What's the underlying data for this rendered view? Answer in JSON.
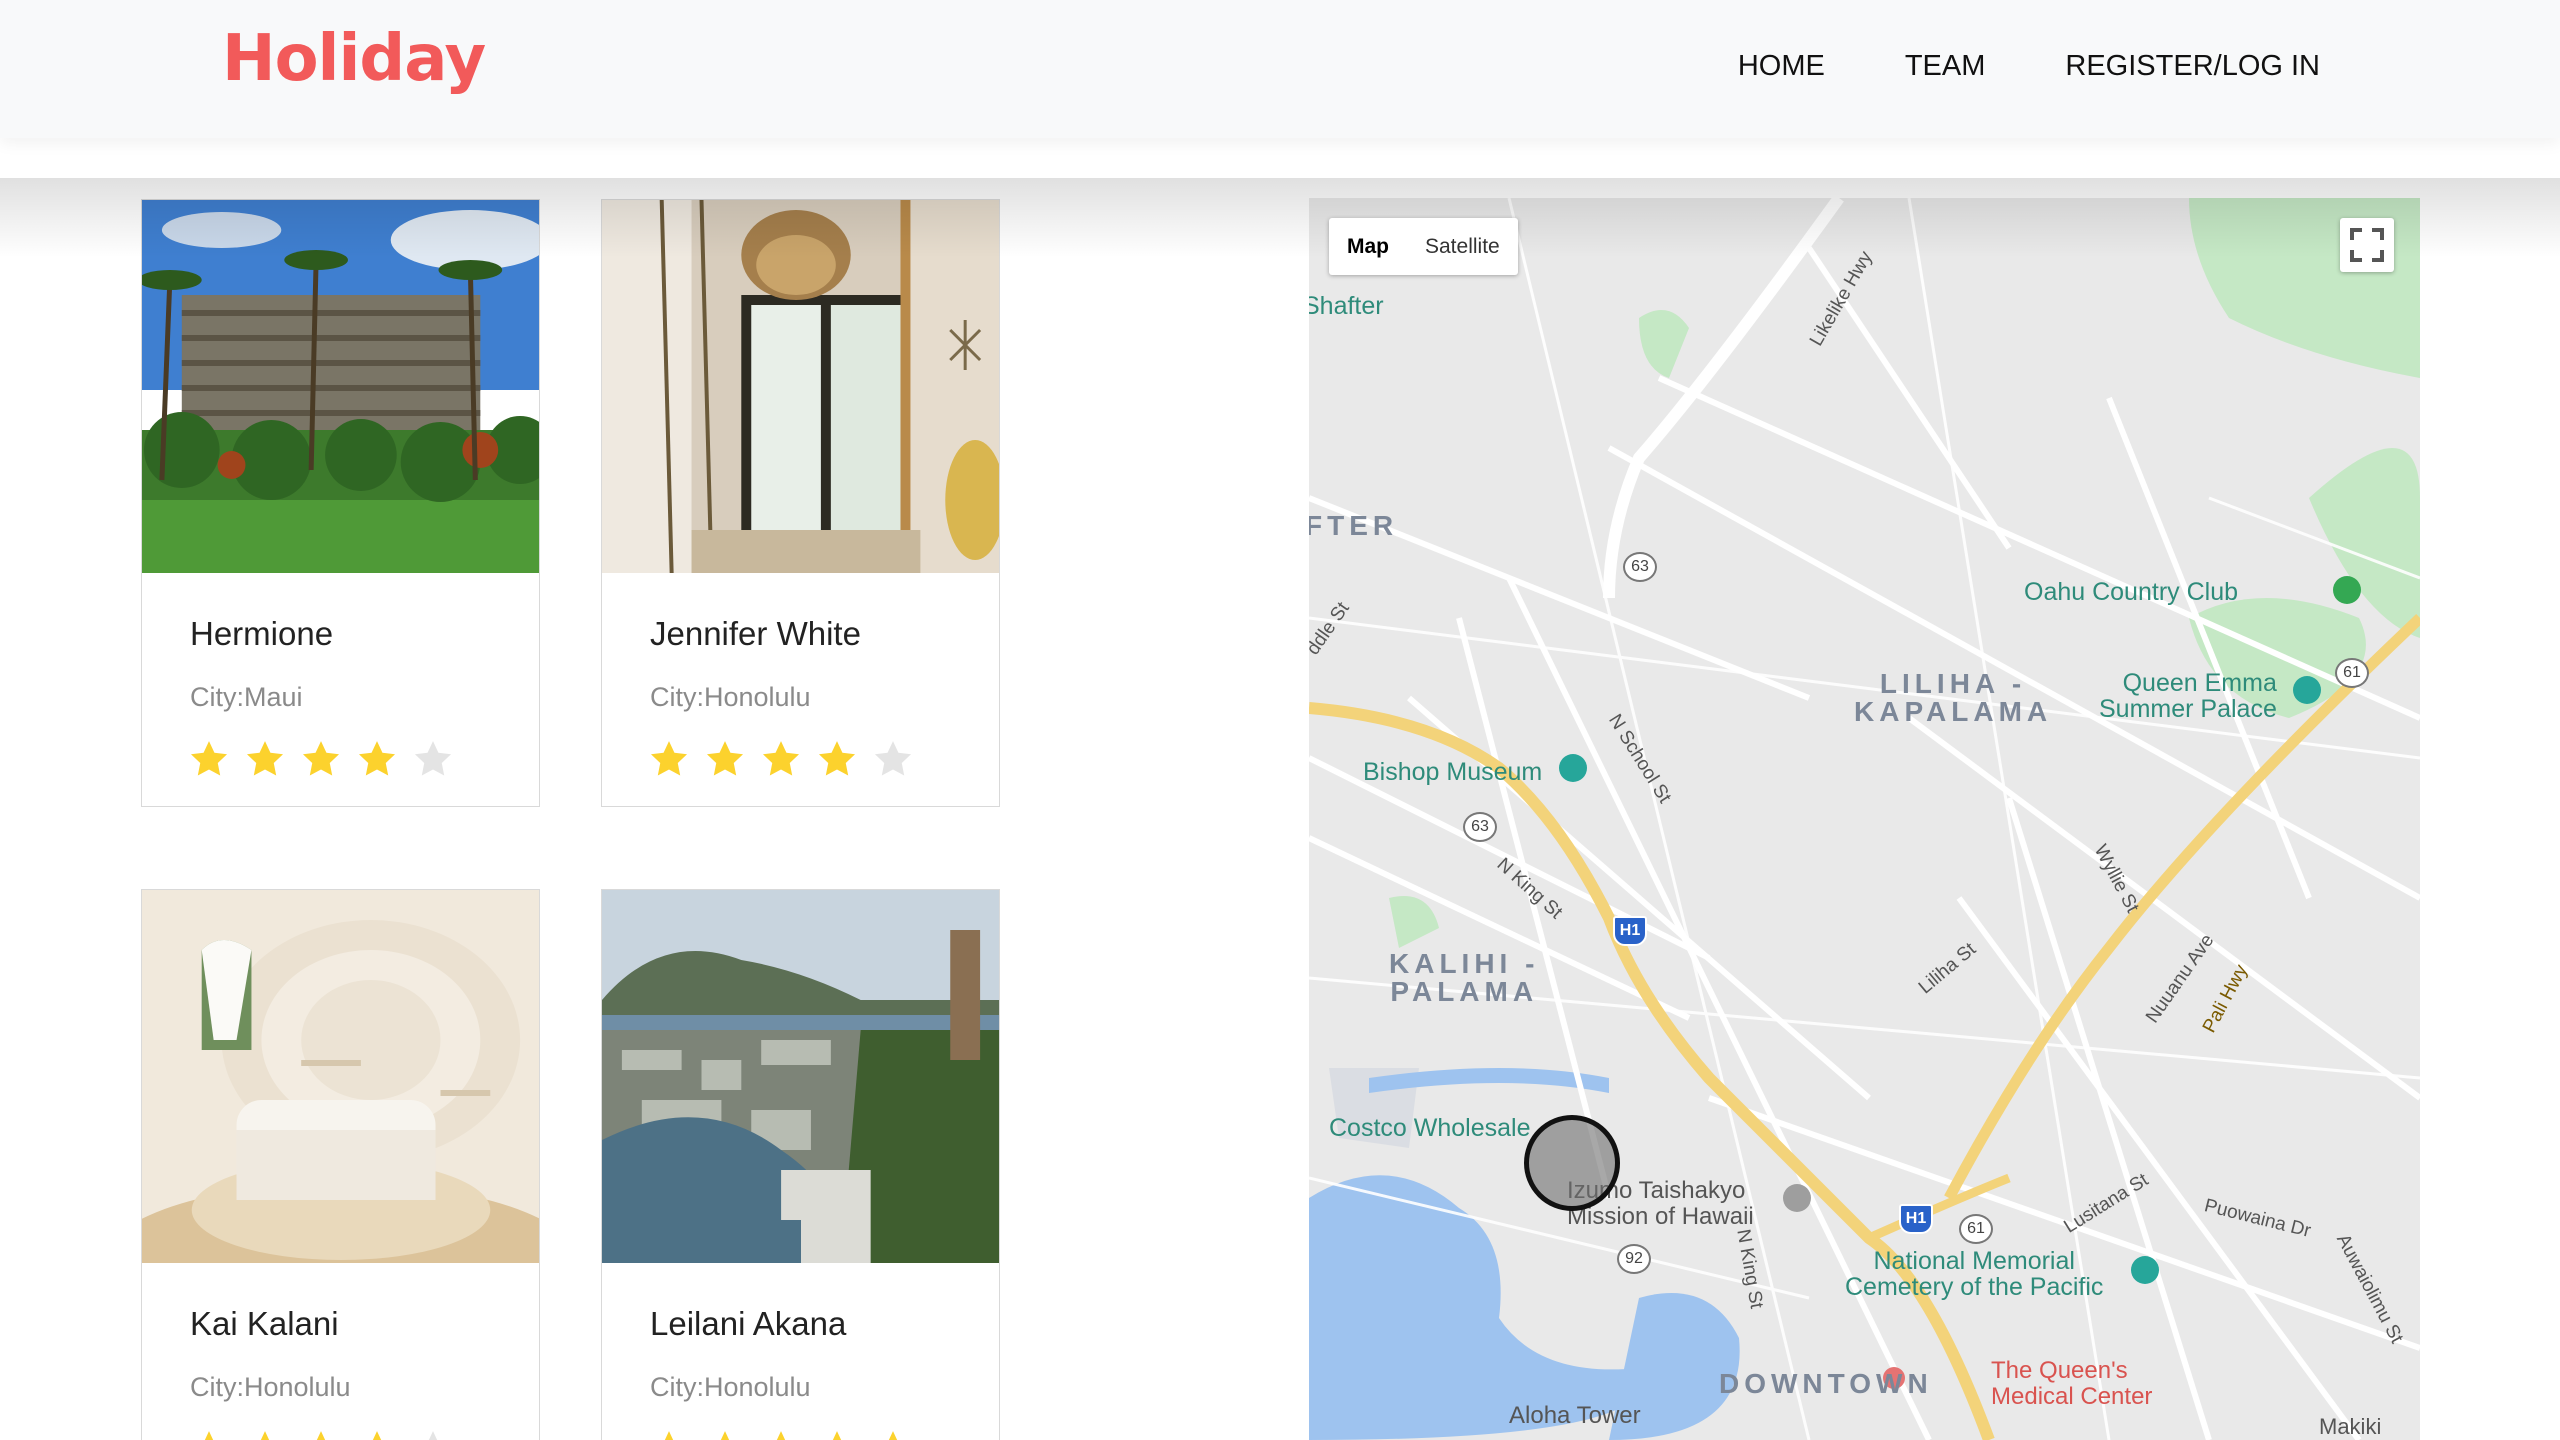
{
  "header": {
    "logo": "Holiday",
    "nav": [
      "HOME",
      "TEAM",
      "REGISTER/LOG IN"
    ]
  },
  "listings": [
    {
      "name": "Hermione",
      "city": "City:Maui",
      "rating": 4,
      "max_rating": 5
    },
    {
      "name": "Jennifer White",
      "city": "City:Honolulu",
      "rating": 4,
      "max_rating": 5
    },
    {
      "name": "Kai Kalani",
      "city": "City:Honolulu",
      "rating": 4,
      "max_rating": 5
    },
    {
      "name": "Leilani Akana",
      "city": "City:Honolulu",
      "rating": 5,
      "max_rating": 5
    }
  ],
  "map": {
    "type_buttons": [
      "Map",
      "Satellite"
    ],
    "active_type": "Map",
    "areas": [
      "LILIHA -\nKAPALAMA",
      "KALIHI -\nPALAMA",
      "DOWNTOWN",
      "FTER"
    ],
    "pois": [
      "Oahu Country Club",
      "Queen Emma\nSummer Palace",
      "Bishop Museum",
      "Costco Wholesale",
      "Izumo Taishakyo\nMission of Hawaii",
      "National Memorial\nCemetery of the Pacific",
      "The Queen's\nMedical Center",
      "Aloha Tower",
      "Shafter",
      "Makiki"
    ],
    "streets": [
      "Likelike Hwy",
      "N School St",
      "N King St",
      "Liliha St",
      "Wyllie St",
      "Nuuanu Ave",
      "Pali Hwy",
      "Lusitana St",
      "Puowaina Dr",
      "Auwaiolimu St",
      "N King St",
      "ddle St"
    ],
    "routes": [
      "63",
      "63",
      "61",
      "61",
      "92"
    ],
    "interstates": [
      "H1",
      "H1"
    ]
  },
  "colors": {
    "brand": "#f25a5a",
    "star_filled": "#fcd22d",
    "star_empty": "#e4e4e4"
  }
}
